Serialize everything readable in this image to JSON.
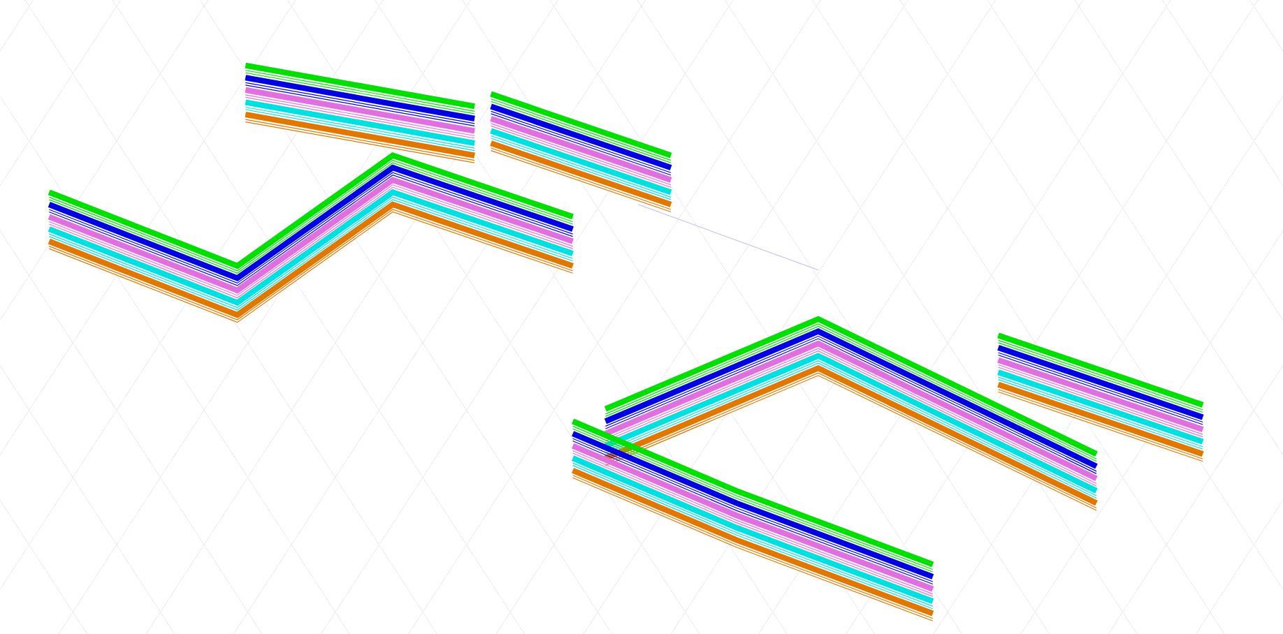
{
  "viewport": {
    "assemblies": [
      {
        "layers": [
          {
            "color": "#e07800"
          },
          {
            "color": "#00e0e0"
          },
          {
            "color": "#e070e0"
          },
          {
            "color": "#0000e0"
          },
          {
            "color": "#00e000"
          }
        ]
      },
      {
        "layers": [
          {
            "color": "#e07800"
          },
          {
            "color": "#00e0e0"
          },
          {
            "color": "#e070e0"
          },
          {
            "color": "#0000e0"
          },
          {
            "color": "#00e000"
          }
        ]
      }
    ]
  }
}
